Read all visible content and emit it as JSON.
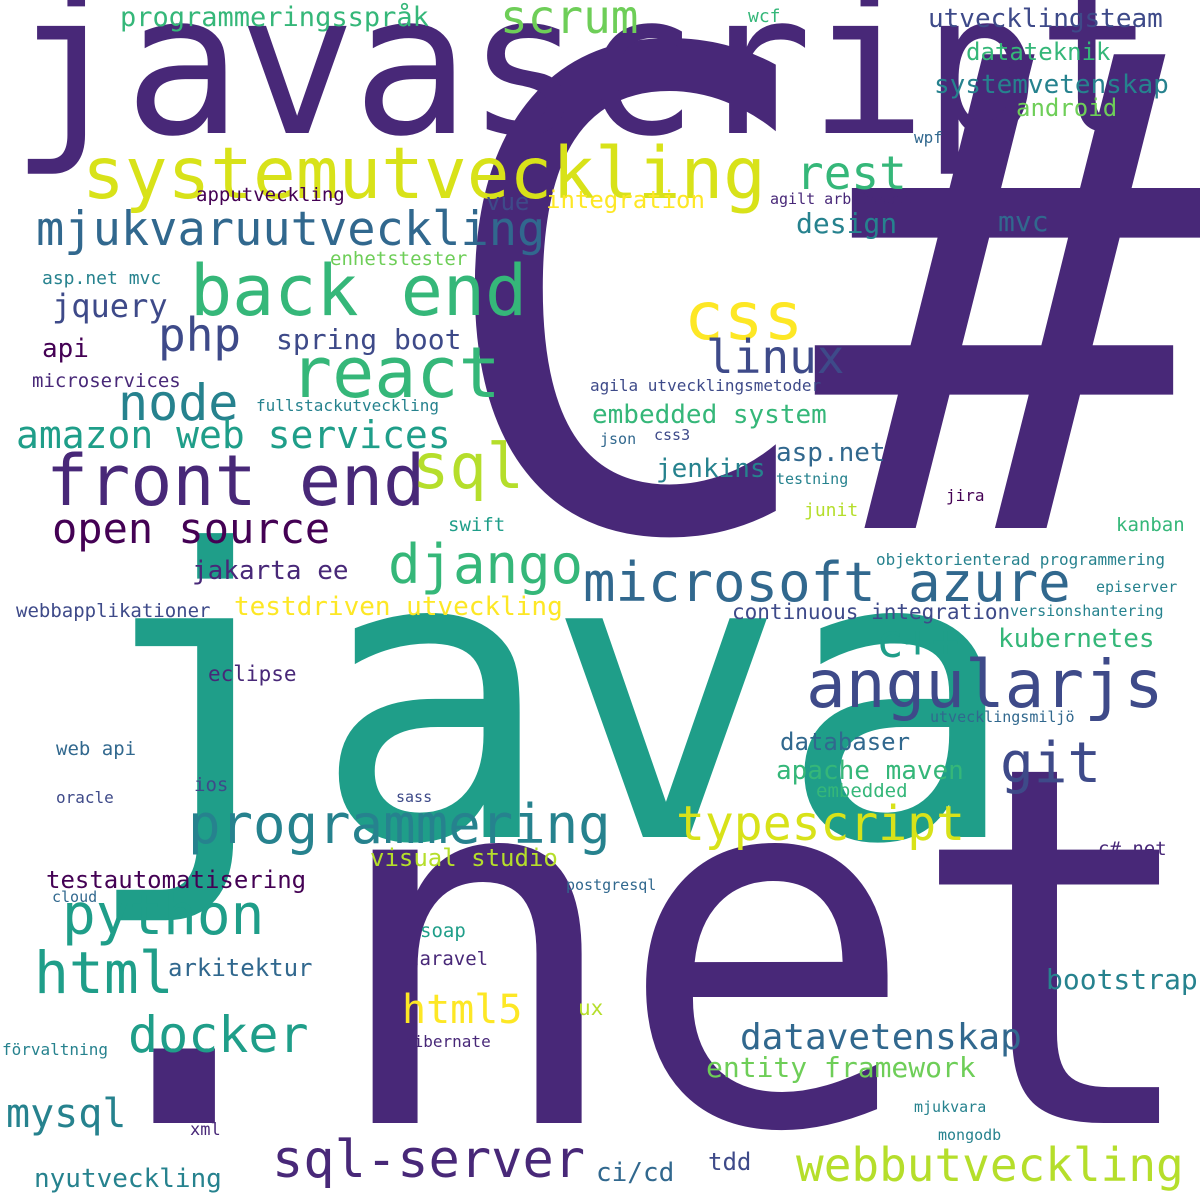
{
  "palette": {
    "dark_purple": "#482878",
    "indigo": "#3e4a89",
    "blue": "#31688e",
    "teal_blue": "#26828e",
    "teal": "#1f9e89",
    "green": "#35b779",
    "light_green": "#6ece58",
    "yellow_green": "#b5de2b",
    "yellow": "#fde725",
    "background": "#ffffff"
  },
  "words": [
    {
      "id": "csharp",
      "text": "C#",
      "color": "#482878",
      "weight": 100
    },
    {
      "id": "java",
      "text": "java",
      "color": "#1f9e89",
      "weight": 95
    },
    {
      "id": "dotnet",
      "text": ".net",
      "color": "#482878",
      "weight": 90
    },
    {
      "id": "javascript",
      "text": "javascript",
      "color": "#482878",
      "weight": 70
    },
    {
      "id": "systemutveckling",
      "text": "systemutveckling",
      "color": "#d8e219",
      "weight": 40
    },
    {
      "id": "back-end",
      "text": "back end",
      "color": "#35b779",
      "weight": 38
    },
    {
      "id": "front-end",
      "text": "front end",
      "color": "#482878",
      "weight": 38
    },
    {
      "id": "react",
      "text": "react",
      "color": "#35b779",
      "weight": 37
    },
    {
      "id": "angularjs",
      "text": "angularjs",
      "color": "#3e4a89",
      "weight": 35
    },
    {
      "id": "microsoft-azure",
      "text": "microsoft azure",
      "color": "#31688e",
      "weight": 30
    },
    {
      "id": "programmering",
      "text": "programmering",
      "color": "#26828e",
      "weight": 30
    },
    {
      "id": "mjukvaruutveckling",
      "text": "mjukvaruutveckling",
      "color": "#31688e",
      "weight": 27
    },
    {
      "id": "python",
      "text": "python",
      "color": "#1f9e89",
      "weight": 30
    },
    {
      "id": "html",
      "text": "html",
      "color": "#1f9e89",
      "weight": 30
    },
    {
      "id": "sql-server",
      "text": "sql-server",
      "color": "#482878",
      "weight": 28
    },
    {
      "id": "webbutveckling",
      "text": "webbutveckling",
      "color": "#b5de2b",
      "weight": 28
    },
    {
      "id": "django",
      "text": "django",
      "color": "#35b779",
      "weight": 28
    },
    {
      "id": "docker",
      "text": "docker",
      "color": "#1f9e89",
      "weight": 27
    },
    {
      "id": "git",
      "text": "git",
      "color": "#3e4a89",
      "weight": 30
    },
    {
      "id": "typescript",
      "text": "typescript",
      "color": "#d8e219",
      "weight": 27
    },
    {
      "id": "css",
      "text": "css",
      "color": "#fde725",
      "weight": 30
    },
    {
      "id": "sql",
      "text": "sql",
      "color": "#b5de2b",
      "weight": 28
    },
    {
      "id": "node",
      "text": "node",
      "color": "#26828e",
      "weight": 26
    },
    {
      "id": "open-source",
      "text": "open source",
      "color": "#440154",
      "weight": 24
    },
    {
      "id": "amazon-web-services",
      "text": "amazon web services",
      "color": "#1f9e89",
      "weight": 22
    },
    {
      "id": "scrum",
      "text": "scrum",
      "color": "#6ece58",
      "weight": 24
    },
    {
      "id": "rest",
      "text": "rest",
      "color": "#35b779",
      "weight": 22
    },
    {
      "id": "linux",
      "text": "linux",
      "color": "#3e4a89",
      "weight": 24
    },
    {
      "id": "php",
      "text": "php",
      "color": "#3e4a89",
      "weight": 24
    },
    {
      "id": "cpp",
      "text": "c++",
      "color": "#1f9e89",
      "weight": 24
    },
    {
      "id": "datavetenskap",
      "text": "datavetenskap",
      "color": "#31688e",
      "weight": 20
    },
    {
      "id": "html5",
      "text": "html5",
      "color": "#fde725",
      "weight": 20
    },
    {
      "id": "mysql",
      "text": "mysql",
      "color": "#26828e",
      "weight": 20
    },
    {
      "id": "programmeringssprak",
      "text": "programmeringsspråk",
      "color": "#35b779",
      "weight": 16
    },
    {
      "id": "utvecklingsteam",
      "text": "utvecklingsteam",
      "color": "#3e4a89",
      "weight": 15
    },
    {
      "id": "datateknik",
      "text": "datateknik",
      "color": "#35b779",
      "weight": 14
    },
    {
      "id": "systemvetenskap",
      "text": "systemvetenskap",
      "color": "#26828e",
      "weight": 15
    },
    {
      "id": "android",
      "text": "android",
      "color": "#6ece58",
      "weight": 14
    },
    {
      "id": "wcf",
      "text": "wcf",
      "color": "#35b779",
      "weight": 12
    },
    {
      "id": "wpf",
      "text": "wpf",
      "color": "#31688e",
      "weight": 10
    },
    {
      "id": "apputveckling",
      "text": "apputveckling",
      "color": "#440154",
      "weight": 12
    },
    {
      "id": "integration",
      "text": "integration",
      "color": "#fde725",
      "weight": 14
    },
    {
      "id": "vue",
      "text": "vue",
      "color": "#3e4a89",
      "weight": 14
    },
    {
      "id": "agilt-arbetssatt",
      "text": "agilt arbetssätt",
      "color": "#482878",
      "weight": 10
    },
    {
      "id": "mvc",
      "text": "mvc",
      "color": "#31688e",
      "weight": 16
    },
    {
      "id": "design",
      "text": "design",
      "color": "#26828e",
      "weight": 16
    },
    {
      "id": "enhetstester",
      "text": "enhetstester",
      "color": "#6ece58",
      "weight": 12
    },
    {
      "id": "aspnet-mvc",
      "text": "asp.net mvc",
      "color": "#26828e",
      "weight": 12
    },
    {
      "id": "jquery",
      "text": "jquery",
      "color": "#3e4a89",
      "weight": 18
    },
    {
      "id": "api",
      "text": "api",
      "color": "#440154",
      "weight": 15
    },
    {
      "id": "spring-boot",
      "text": "spring boot",
      "color": "#3e4a89",
      "weight": 16
    },
    {
      "id": "microservices",
      "text": "microservices",
      "color": "#482878",
      "weight": 12
    },
    {
      "id": "fullstackutveckling",
      "text": "fullstackutveckling",
      "color": "#26828e",
      "weight": 10
    },
    {
      "id": "agila-utvecklingsmetoder",
      "text": "agila utvecklingsmetoder",
      "color": "#3e4a89",
      "weight": 10
    },
    {
      "id": "embedded-system",
      "text": "embedded system",
      "color": "#35b779",
      "weight": 16
    },
    {
      "id": "json",
      "text": "json",
      "color": "#31688e",
      "weight": 10
    },
    {
      "id": "css3",
      "text": "css3",
      "color": "#3e4a89",
      "weight": 10
    },
    {
      "id": "aspnet",
      "text": "asp.net",
      "color": "#31688e",
      "weight": 16
    },
    {
      "id": "jenkins",
      "text": "jenkins",
      "color": "#26828e",
      "weight": 16
    },
    {
      "id": "testning",
      "text": "testning",
      "color": "#26828e",
      "weight": 10
    },
    {
      "id": "jira",
      "text": "jira",
      "color": "#440154",
      "weight": 10
    },
    {
      "id": "junit",
      "text": "junit",
      "color": "#b5de2b",
      "weight": 11
    },
    {
      "id": "swift",
      "text": "swift",
      "color": "#1f9e89",
      "weight": 12
    },
    {
      "id": "kanban",
      "text": "kanban",
      "color": "#35b779",
      "weight": 12
    },
    {
      "id": "objektorienterad-programmering",
      "text": "objektorienterad programmering",
      "color": "#26828e",
      "weight": 11
    },
    {
      "id": "episerver",
      "text": "episerver",
      "color": "#26828e",
      "weight": 10
    },
    {
      "id": "versionshantering",
      "text": "versionshantering",
      "color": "#26828e",
      "weight": 10
    },
    {
      "id": "jakarta-ee",
      "text": "jakarta ee",
      "color": "#482878",
      "weight": 16
    },
    {
      "id": "testdriven-utveckling",
      "text": "testdriven utveckling",
      "color": "#fde725",
      "weight": 16
    },
    {
      "id": "webbapplikationer",
      "text": "webbapplikationer",
      "color": "#3e4a89",
      "weight": 12
    },
    {
      "id": "continuous-integration",
      "text": "continuous integration",
      "color": "#3e4a89",
      "weight": 14
    },
    {
      "id": "kubernetes",
      "text": "kubernetes",
      "color": "#35b779",
      "weight": 16
    },
    {
      "id": "eclipse",
      "text": "eclipse",
      "color": "#482878",
      "weight": 14
    },
    {
      "id": "utvecklingsmiljo",
      "text": "utvecklingsmiljö",
      "color": "#31688e",
      "weight": 10
    },
    {
      "id": "databaser",
      "text": "databaser",
      "color": "#31688e",
      "weight": 16
    },
    {
      "id": "apache-maven",
      "text": "apache maven",
      "color": "#35b779",
      "weight": 16
    },
    {
      "id": "web-api",
      "text": "web api",
      "color": "#31688e",
      "weight": 12
    },
    {
      "id": "ios",
      "text": "ios",
      "color": "#3e4a89",
      "weight": 12
    },
    {
      "id": "oracle",
      "text": "oracle",
      "color": "#3e4a89",
      "weight": 10
    },
    {
      "id": "sass",
      "text": "sass",
      "color": "#3e4a89",
      "weight": 10
    },
    {
      "id": "embedded",
      "text": "embedded",
      "color": "#35b779",
      "weight": 12
    },
    {
      "id": "visual-studio",
      "text": "visual studio",
      "color": "#b5de2b",
      "weight": 16
    },
    {
      "id": "csharp-net",
      "text": "c#.net",
      "color": "#482878",
      "weight": 12
    },
    {
      "id": "testautomatisering",
      "text": "testautomatisering",
      "color": "#440154",
      "weight": 16
    },
    {
      "id": "postgresql",
      "text": "postgresql",
      "color": "#31688e",
      "weight": 10
    },
    {
      "id": "cloud",
      "text": "cloud",
      "color": "#31688e",
      "weight": 10
    },
    {
      "id": "soap",
      "text": "soap",
      "color": "#1f9e89",
      "weight": 12
    },
    {
      "id": "arkitektur",
      "text": "arkitektur",
      "color": "#31688e",
      "weight": 14
    },
    {
      "id": "laravel",
      "text": "laravel",
      "color": "#482878",
      "weight": 12
    },
    {
      "id": "bootstrap",
      "text": "bootstrap",
      "color": "#26828e",
      "weight": 16
    },
    {
      "id": "ux",
      "text": "ux",
      "color": "#b5de2b",
      "weight": 12
    },
    {
      "id": "entity-framework",
      "text": "entity framework",
      "color": "#6ece58",
      "weight": 16
    },
    {
      "id": "forvaltning",
      "text": "förvaltning",
      "color": "#26828e",
      "weight": 10
    },
    {
      "id": "hibernate",
      "text": "hibernate",
      "color": "#482878",
      "weight": 10
    },
    {
      "id": "xml",
      "text": "xml",
      "color": "#482878",
      "weight": 10
    },
    {
      "id": "mjukvara",
      "text": "mjukvara",
      "color": "#26828e",
      "weight": 10
    },
    {
      "id": "mongodb",
      "text": "mongodb",
      "color": "#26828e",
      "weight": 10
    },
    {
      "id": "ci-cd",
      "text": "ci/cd",
      "color": "#31688e",
      "weight": 14
    },
    {
      "id": "tdd",
      "text": "tdd",
      "color": "#3e4a89",
      "weight": 14
    },
    {
      "id": "nyutveckling",
      "text": "nyutveckling",
      "color": "#26828e",
      "weight": 16
    }
  ]
}
